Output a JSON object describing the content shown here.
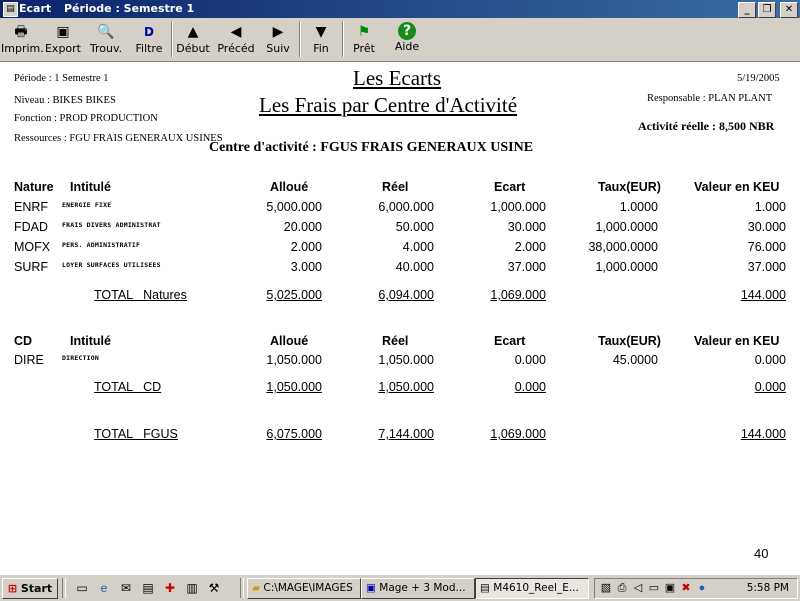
{
  "window": {
    "app_name": "Ecart",
    "title": "Période : Semestre 1",
    "controls": {
      "minimize": "_",
      "maximize": "❐",
      "close": "✕"
    }
  },
  "toolbar": [
    {
      "label": "Imprim.",
      "icon": "printer-icon"
    },
    {
      "label": "Export",
      "icon": "disk-icon"
    },
    {
      "label": "Trouv.",
      "icon": "find-icon"
    },
    {
      "label": "Filtre",
      "icon": "filter-icon"
    },
    {
      "label": "Début",
      "icon": "arrow-up-icon"
    },
    {
      "label": "Précéd",
      "icon": "arrow-left-icon"
    },
    {
      "label": "Suiv",
      "icon": "arrow-right-icon"
    },
    {
      "label": "Fin",
      "icon": "arrow-down-icon"
    },
    {
      "label": "Prêt",
      "icon": "flag-icon"
    },
    {
      "label": "Aide",
      "icon": "help-icon"
    }
  ],
  "report": {
    "left_info": {
      "periode": "Période : 1  Semestre 1",
      "niveau": "Niveau : BIKES  BIKES",
      "fonction": "Fonction : PROD  PRODUCTION",
      "ressources": "Ressources :  FGU  FRAIS GENERAUX USINES"
    },
    "title": "Les Ecarts",
    "subtitle": "Les Frais par Centre d'Activité",
    "date": "5/19/2005",
    "responsable": "Responsable : PLAN  PLANT",
    "activite": "Activité réelle : 8,500 NBR",
    "centre": "Centre d'activité :  FGUS  FRAIS GENERAUX USINE",
    "columns1": {
      "code": "Nature",
      "intitule": "Intitulé",
      "alloue": "Alloué",
      "reel": "Réel",
      "ecart": "Ecart",
      "taux": "Taux(EUR)",
      "valeur": "Valeur en KEU"
    },
    "natures": [
      {
        "code": "ENRF",
        "intitule": "ENERGIE FIXE",
        "alloue": "5,000.000",
        "reel": "6,000.000",
        "ecart": "1,000.000",
        "taux": "1.0000",
        "valeur": "1.000"
      },
      {
        "code": "FDAD",
        "intitule": "FRAIS DIVERS ADMINISTRAT",
        "alloue": "20.000",
        "reel": "50.000",
        "ecart": "30.000",
        "taux": "1,000.0000",
        "valeur": "30.000"
      },
      {
        "code": "MOFX",
        "intitule": "PERS. ADMINISTRATIF",
        "alloue": "2.000",
        "reel": "4.000",
        "ecart": "2.000",
        "taux": "38,000.0000",
        "valeur": "76.000"
      },
      {
        "code": "SURF",
        "intitule": "LOYER SURFACES UTILISEES",
        "alloue": "3.000",
        "reel": "40.000",
        "ecart": "37.000",
        "taux": "1,000.0000",
        "valeur": "37.000"
      }
    ],
    "total_natures": {
      "label": "TOTAL   Natures",
      "alloue": "5,025.000",
      "reel": "6,094.000",
      "ecart": "1,069.000",
      "valeur": "144.000"
    },
    "columns2": {
      "code": "CD",
      "intitule": "Intitulé",
      "alloue": "Alloué",
      "reel": "Réel",
      "ecart": "Ecart",
      "taux": "Taux(EUR)",
      "valeur": "Valeur en KEU"
    },
    "cds": [
      {
        "code": "DIRE",
        "intitule": "DIRECTION",
        "alloue": "1,050.000",
        "reel": "1,050.000",
        "ecart": "0.000",
        "taux": "45.0000",
        "valeur": "0.000"
      }
    ],
    "total_cd": {
      "label": "TOTAL   CD",
      "alloue": "1,050.000",
      "reel": "1,050.000",
      "ecart": "0.000",
      "valeur": "0.000"
    },
    "total_fgus": {
      "label": "TOTAL   FGUS",
      "alloue": "6,075.000",
      "reel": "7,144.000",
      "ecart": "1,069.000",
      "valeur": "144.000"
    },
    "page_number": "40"
  },
  "taskbar": {
    "start_label": "Start",
    "tasks": [
      {
        "label": "C:\\MAGE\\IMAGES"
      },
      {
        "label": "Mage + 3   Mod..."
      },
      {
        "label": "M4610_Reel_E..."
      }
    ],
    "clock": "5:58 PM"
  }
}
